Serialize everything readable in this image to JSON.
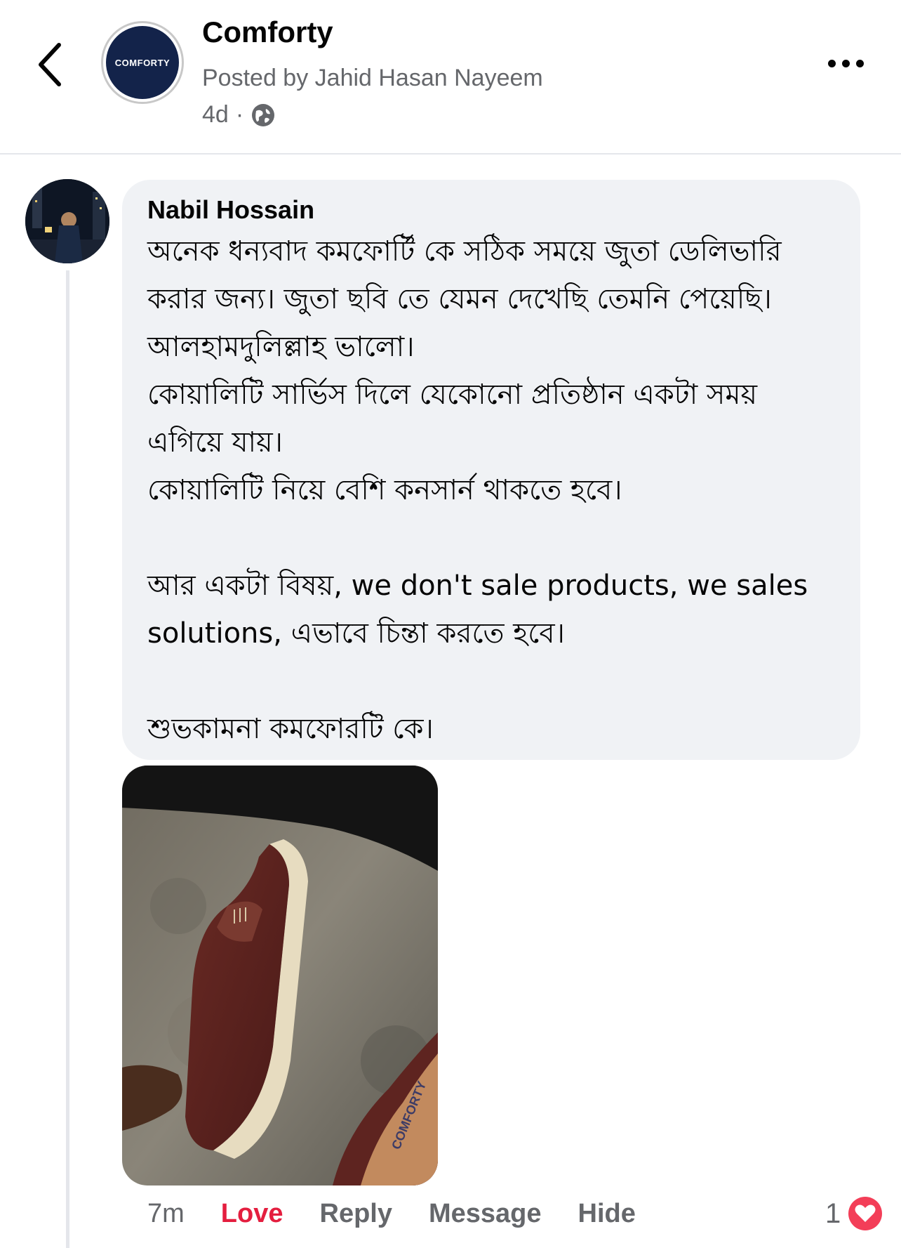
{
  "header": {
    "page_name": "Comforty",
    "logo_text": "COMFORTY",
    "posted_by": "Posted by Jahid Hasan Nayeem",
    "age": "4d",
    "separator": "·",
    "privacy_icon": "globe-icon"
  },
  "comment": {
    "author": "Nabil Hossain",
    "lines": [
      "অনেক ধন্যবাদ কমফোর্টি কে সঠিক সময়ে জুতা ডেলিভারি",
      "করার জন্য। জুতা ছবি তে যেমন দেখেছি তেমনি পেয়েছি।",
      "আলহামদুলিল্লাহ ভালো।",
      "কোয়ালিটি সার্ভিস দিলে যেকোনো প্রতিষ্ঠান একটা সময়",
      "এগিয়ে যায়।",
      "কোয়ালিটি নিয়ে বেশি কনসার্ন থাকতে হবে।",
      "আর একটা বিষয়, we don't sale products, we sales",
      "solutions,  এভাবে চিন্তা করতে হবে।",
      "শুভকামনা কমফোরটি কে।"
    ],
    "photo_label": "COMFORTY",
    "time": "7m",
    "love_label": "Love",
    "reply_label": "Reply",
    "message_label": "Message",
    "hide_label": "Hide",
    "reaction_count": "1",
    "reaction_icon": "heart-icon"
  },
  "colors": {
    "bubble": "#f0f2f5",
    "secondary_text": "#65676b",
    "love": "#e41e3f",
    "logo_bg": "#13234a"
  }
}
